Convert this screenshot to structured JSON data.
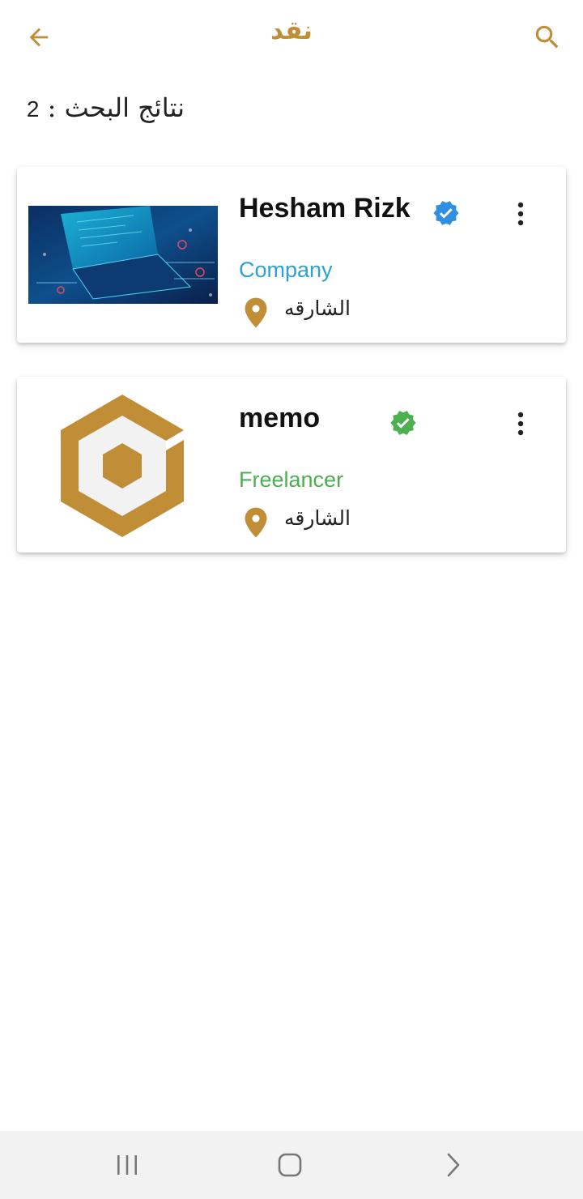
{
  "app_bar": {
    "title": "نقد",
    "back_icon": "arrow-left-icon",
    "search_icon": "search-icon"
  },
  "results": {
    "label": "نتائج البحث :",
    "count": "2"
  },
  "cards": [
    {
      "name": "Hesham Rizk",
      "type": "Company",
      "location": "الشارقه",
      "verified_color": "#2f8fe0",
      "type_color": "#2ba1d6",
      "image": "laptop-tech-thumbnail"
    },
    {
      "name": "memo",
      "type": "Freelancer",
      "location": "الشارقه",
      "verified_color": "#4caf50",
      "type_color": "#4caf50",
      "image": "hexagon-logo"
    }
  ],
  "colors": {
    "accent": "#c08e36",
    "nav_bar": "#f2f2f2"
  },
  "nav_bar": {
    "recent_icon": "recent-apps-icon",
    "home_icon": "home-icon",
    "back_icon": "nav-back-icon"
  }
}
